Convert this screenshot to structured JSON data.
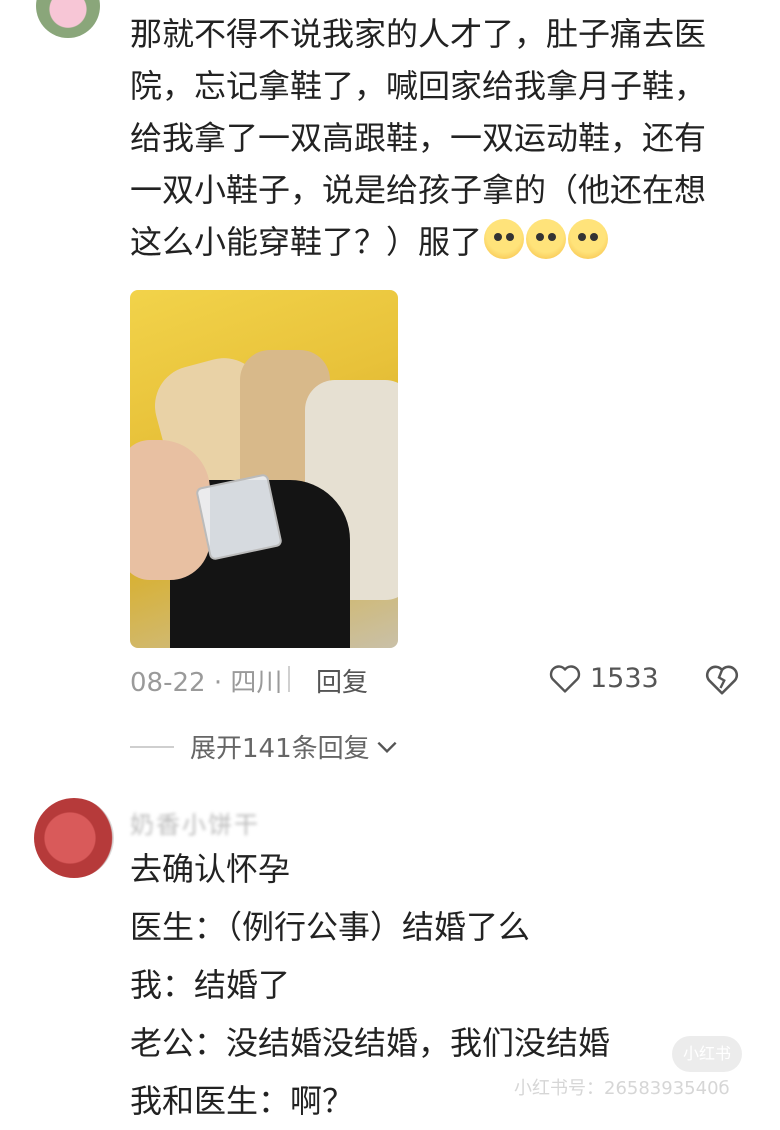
{
  "comment1": {
    "lines": [
      "那就不得不说我家的人才了，肚子痛去医",
      "院，忘记拿鞋了，喊回家给我拿月子鞋，",
      "给我拿了一双高跟鞋，一双运动鞋，还有",
      "一双小鞋子，说是给孩子拿的（他还在想",
      "这么小能穿鞋了？）服了"
    ],
    "emoji_names": [
      "pleading-face-icon",
      "pleading-face-icon",
      "pleading-face-icon"
    ],
    "date": "08-22 · 四川",
    "reply_label": "回复",
    "like_count": "1533",
    "expand_label": "展开141条回复"
  },
  "comment2": {
    "username": "奶香小饼干",
    "lines": [
      "去确认怀孕",
      "医生：（例行公事）结婚了么",
      "我：结婚了",
      "老公：没结婚没结婚，我们没结婚",
      "我和医生：啊？"
    ]
  },
  "watermark": {
    "logo": "小红书",
    "id": "小红书号：2658393540б"
  },
  "colors": {
    "text": "#222222",
    "meta": "#9a9a9a",
    "photo_bag": "#f2d34a"
  }
}
